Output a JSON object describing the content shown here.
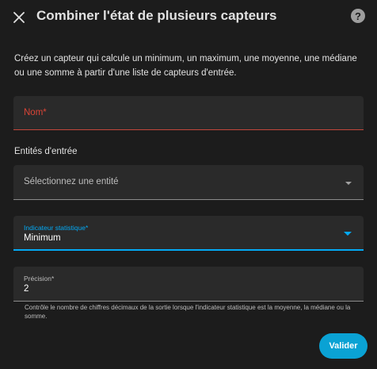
{
  "dialog": {
    "title": "Combiner l'état de plusieurs capteurs",
    "help_symbol": "?",
    "close_icon": "close-icon",
    "help_icon": "help-circle-icon"
  },
  "description": "Créez un capteur qui calcule un minimum, un maximum, une moyenne, une médiane ou une somme à partir d'une liste de capteurs d'entrée.",
  "form": {
    "name_field": {
      "placeholder": "Nom*",
      "value": ""
    },
    "entities_section_label": "Entités d'entrée",
    "entity_select": {
      "placeholder": "Sélectionnez une entité"
    },
    "stat_select": {
      "label": "Indicateur statistique*",
      "value": "Minimum"
    },
    "precision_field": {
      "label": "Précision*",
      "value": "2",
      "helper": "Contrôle le nombre de chiffres décimaux de la sortie lorsque l'indicateur statistique est la moyenne, la médiane ou la somme."
    }
  },
  "actions": {
    "submit_label": "Valider"
  },
  "colors": {
    "accent": "#03a9f4",
    "button": "#0aa2d4",
    "error": "#db4437",
    "background": "#1c1c1c",
    "field_background": "#2a2a2a"
  }
}
